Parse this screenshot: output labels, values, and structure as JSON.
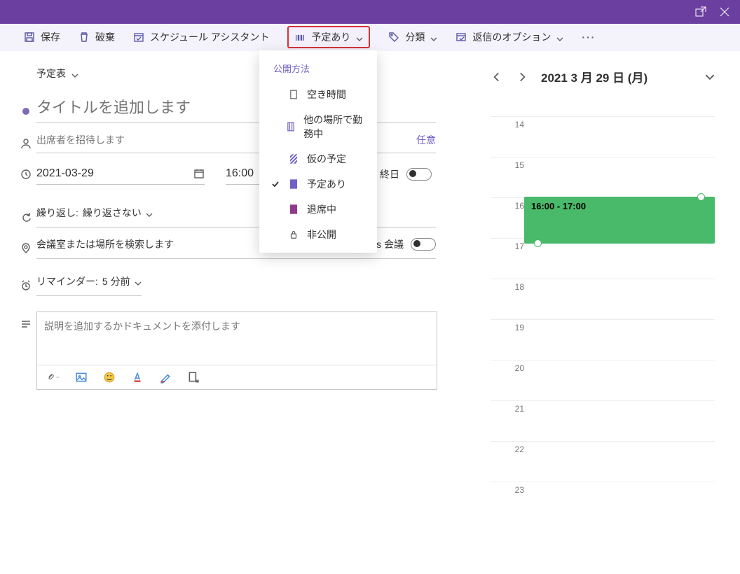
{
  "toolbar": {
    "save": "保存",
    "discard": "破棄",
    "sched": "スケジュール アシスタント",
    "busy": "予定あり",
    "classify": "分類",
    "reply": "返信のオプション"
  },
  "calendarPicker": "予定表",
  "title_placeholder": "タイトルを追加します",
  "attendees_placeholder": "出席者を招待します",
  "optional": "任意",
  "date": "2021-03-29",
  "time": "16:00",
  "allday": "終日",
  "repeat_label": "繰り返し:",
  "repeat_value": "繰り返さない",
  "location_placeholder": "会議室または場所を検索します",
  "teams": "Teams 会議",
  "reminder_label": "リマインダー:",
  "reminder_value": "5 分前",
  "editor_placeholder": "説明を追加するかドキュメントを添付します",
  "dropdown": {
    "header": "公開方法",
    "items": [
      "空き時間",
      "他の場所で勤務中",
      "仮の予定",
      "予定あり",
      "退席中",
      "非公開"
    ]
  },
  "day": {
    "label": "2021 3 月 29 日 (月)",
    "hours": [
      "14",
      "15",
      "16",
      "17",
      "18",
      "19",
      "20",
      "21",
      "22",
      "23"
    ],
    "event": "16:00 - 17:00"
  }
}
